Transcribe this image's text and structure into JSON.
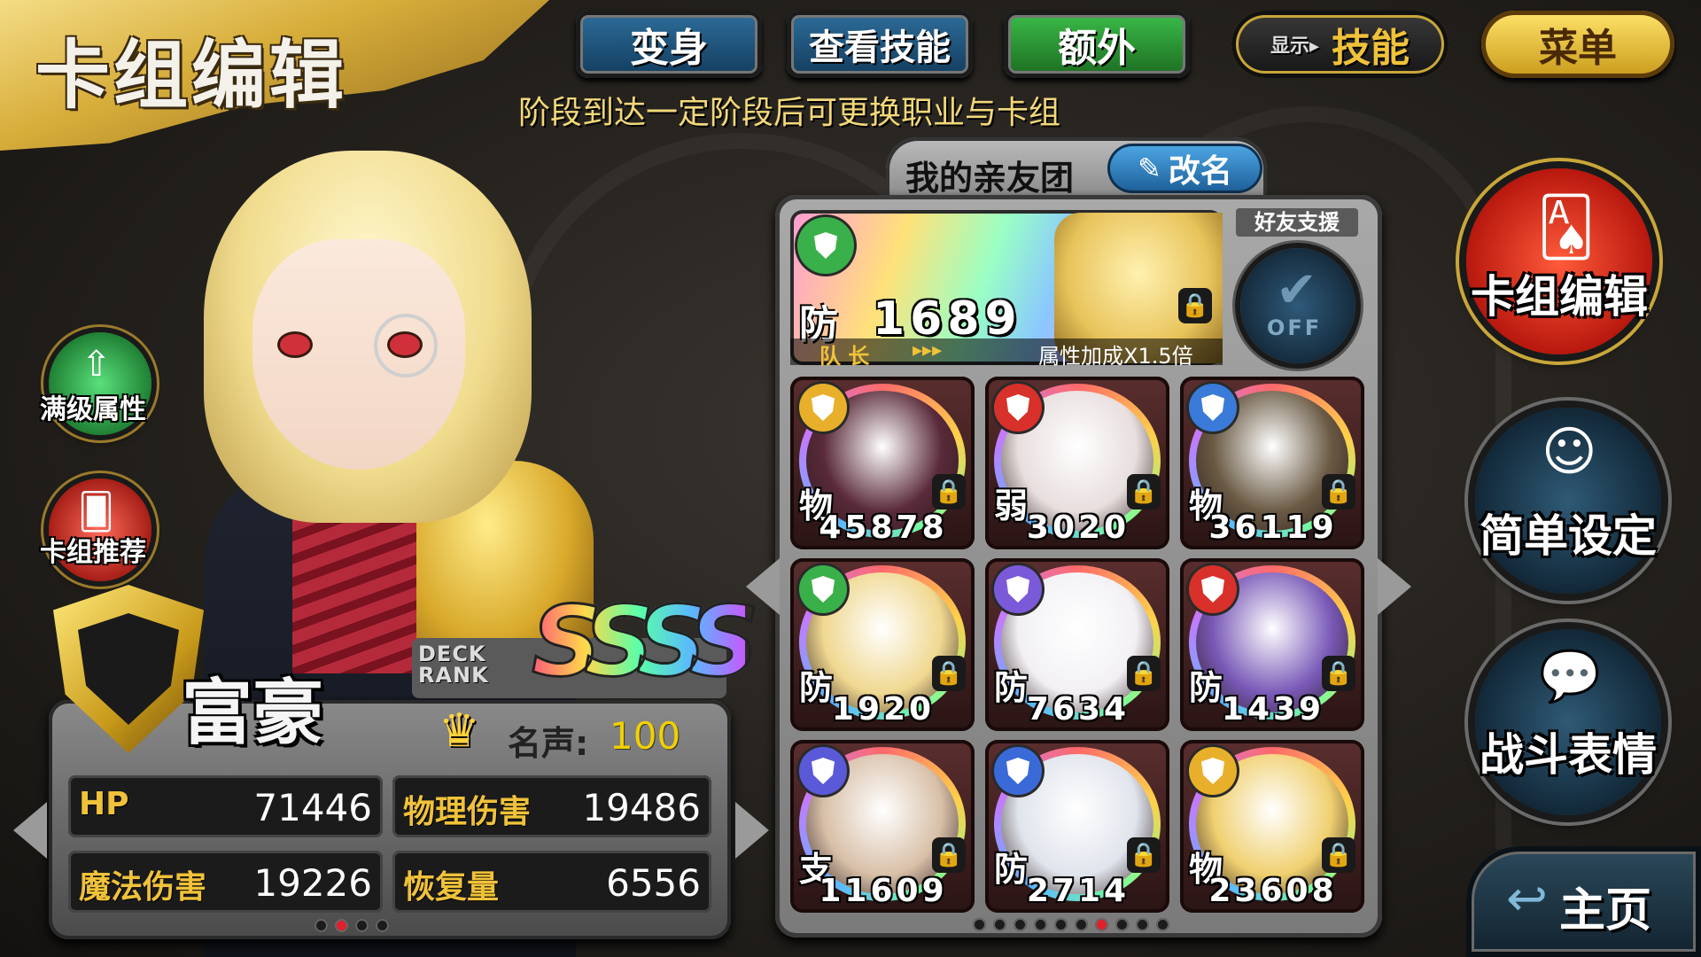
{
  "header": {
    "title": "卡组编辑",
    "subtitle": "阶段到达一定阶段后可更换职业与卡组",
    "buttons": {
      "transform": "变身",
      "view_skills": "查看技能",
      "extra": "额外",
      "display_prefix": "显示▸",
      "display_value": "技能",
      "menu": "菜单"
    }
  },
  "left_buttons": {
    "max_stats": "满级属性",
    "deck_recommend": "卡组推荐"
  },
  "player": {
    "class_name": "富豪",
    "deck_rank_label": "DECK RANK",
    "deck_rank": "SSSS",
    "fame_label": "名声:",
    "fame_value": "100",
    "stats": [
      {
        "label": "HP",
        "value": "71446"
      },
      {
        "label": "物理伤害",
        "value": "19486"
      },
      {
        "label": "魔法伤害",
        "value": "19226"
      },
      {
        "label": "恢复量",
        "value": "6556"
      }
    ],
    "page_indicator": {
      "count": 4,
      "active": 1
    }
  },
  "deck": {
    "name": "我的亲友团",
    "rename": "改名",
    "friend_support": "好友支援",
    "support_state": "OFF",
    "leader": {
      "type": "防",
      "value": "1689",
      "label": "队 长",
      "bonus": "属性加成X1.5倍"
    },
    "cards": [
      {
        "type": "物",
        "value": "45878",
        "badge": "#e8b02a",
        "portrait": "#5a2a3a"
      },
      {
        "type": "弱",
        "value": "3020",
        "badge": "#d8302a",
        "portrait": "#e8dede"
      },
      {
        "type": "物",
        "value": "36119",
        "badge": "#3a7ad8",
        "portrait": "#6a5a44"
      },
      {
        "type": "防",
        "value": "1920",
        "badge": "#3ab04a",
        "portrait": "#f0d890"
      },
      {
        "type": "防",
        "value": "7634",
        "badge": "#7a5ad8",
        "portrait": "#f2f0f4"
      },
      {
        "type": "防",
        "value": "1439",
        "badge": "#d8302a",
        "portrait": "#7a5ab8"
      },
      {
        "type": "支",
        "value": "11609",
        "badge": "#5a5ad8",
        "portrait": "#d8c0a8"
      },
      {
        "type": "防",
        "value": "2714",
        "badge": "#3a6ad8",
        "portrait": "#e0e4ec"
      },
      {
        "type": "物",
        "value": "23608",
        "badge": "#e8b02a",
        "portrait": "#f0d070"
      }
    ],
    "page_indicator": {
      "count": 10,
      "active": 6
    }
  },
  "right_buttons": {
    "deck_edit": "卡组编辑",
    "simple_settings": "简单设定",
    "battle_emotes": "战斗表情",
    "home": "主页"
  },
  "colors": {
    "gold": "#d7ad3a",
    "stat_label": "#f0c23a",
    "fame_value": "#f0d000",
    "active_dot": "#e0202a"
  }
}
